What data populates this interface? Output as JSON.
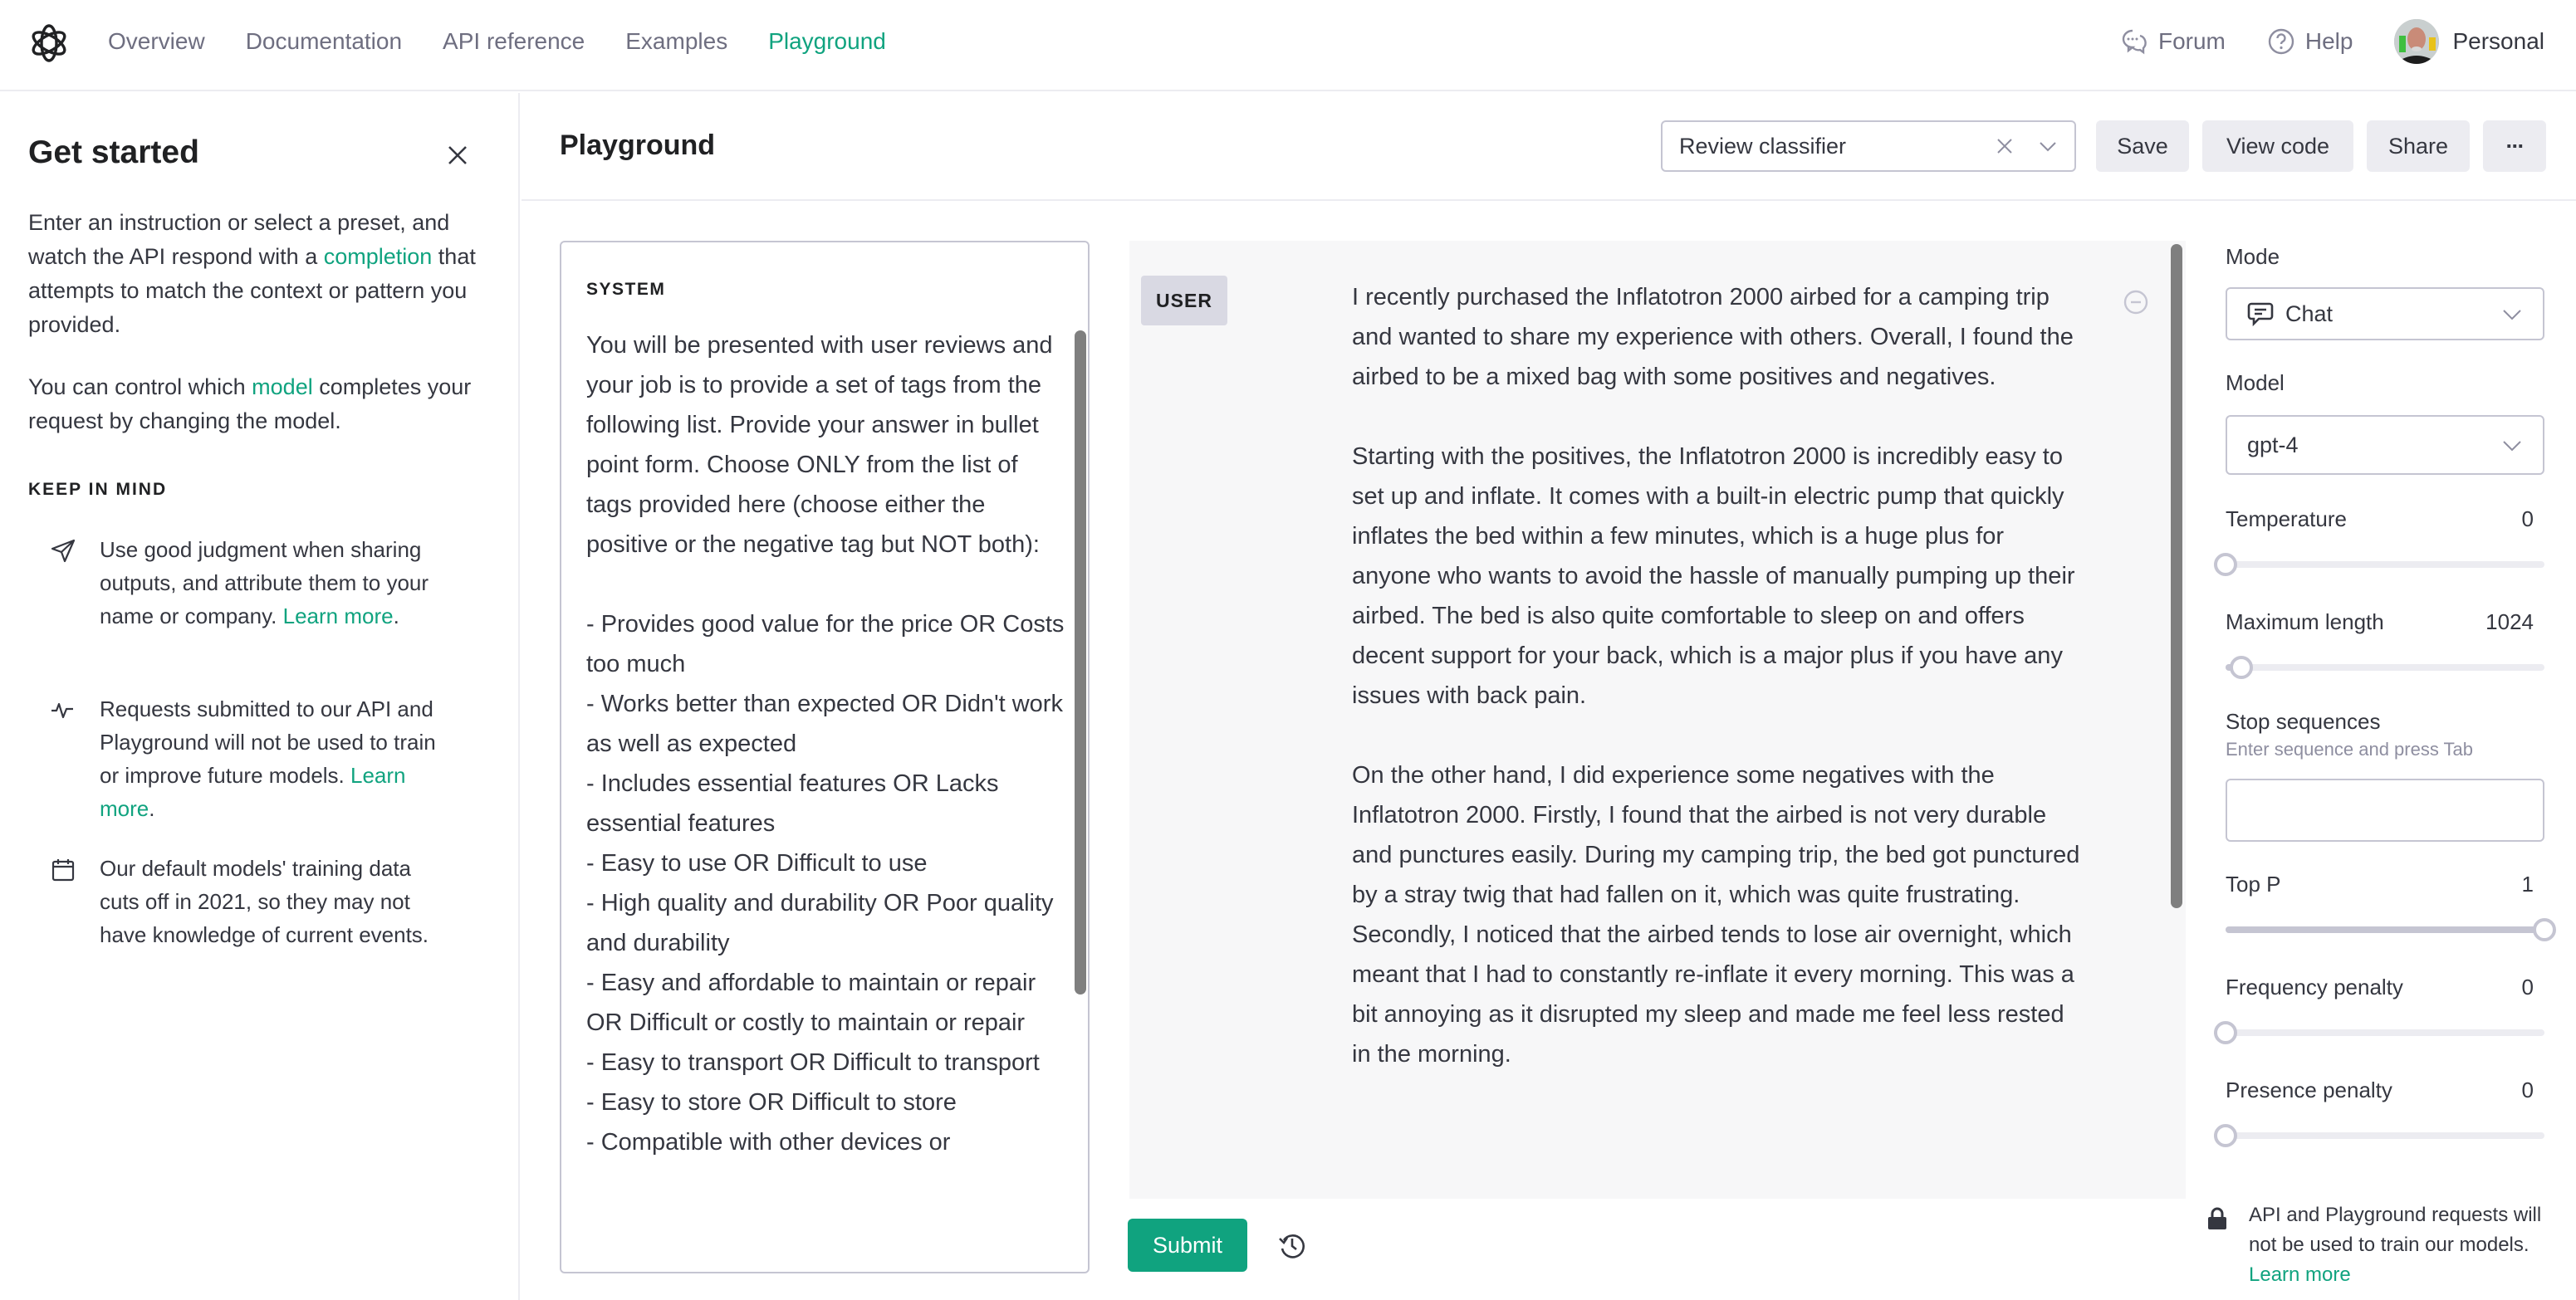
{
  "nav": {
    "links": [
      {
        "label": "Overview",
        "active": false
      },
      {
        "label": "Documentation",
        "active": false
      },
      {
        "label": "API reference",
        "active": false
      },
      {
        "label": "Examples",
        "active": false
      },
      {
        "label": "Playground",
        "active": true
      }
    ],
    "forum_label": "Forum",
    "help_label": "Help",
    "account_label": "Personal"
  },
  "sidebar": {
    "title": "Get started",
    "intro_before_link": "Enter an instruction or select a preset, and watch the API respond with a ",
    "intro_link": "completion",
    "intro_after_link": " that attempts to match the context or pattern you provided.",
    "model_before_link": "You can control which ",
    "model_link": "model",
    "model_after_link": " completes your request by changing the model.",
    "keep_in_mind_heading": "KEEP IN MIND",
    "tips": [
      {
        "icon": "send-icon",
        "text": "Use good judgment when sharing outputs, and attribute them to your name or company. ",
        "link": "Learn more",
        "suffix": "."
      },
      {
        "icon": "activity-icon",
        "text": "Requests submitted to our API and Playground will not be used to train or improve future models. ",
        "link": "Learn more",
        "suffix": "."
      },
      {
        "icon": "calendar-icon",
        "text": "Our default models' training data cuts off in 2021, so they may not have knowledge of current events.",
        "link": "",
        "suffix": ""
      }
    ]
  },
  "header": {
    "title": "Playground",
    "preset_value": "Review classifier",
    "save_label": "Save",
    "view_code_label": "View code",
    "share_label": "Share",
    "more_label": "···"
  },
  "system": {
    "label": "SYSTEM",
    "text": "You will be presented with user reviews and your job is to provide a set of tags from the following list. Provide your answer in bullet point form. Choose ONLY from the list of tags provided here (choose either the positive or the negative tag but NOT both):\n\n- Provides good value for the price OR Costs too much\n- Works better than expected OR Didn't work as well as expected\n- Includes essential features OR Lacks essential features\n- Easy to use OR Difficult to use\n- High quality and durability OR Poor quality and durability\n- Easy and affordable to maintain or repair OR Difficult or costly to maintain or repair\n- Easy to transport OR Difficult to transport\n- Easy to store OR Difficult to store\n- Compatible with other devices or"
  },
  "messages": [
    {
      "role": "USER",
      "paragraphs": [
        "I recently purchased the Inflatotron 2000 airbed for a camping trip and wanted to share my experience with others. Overall, I found the airbed to be a mixed bag with some positives and negatives.",
        "Starting with the positives, the Inflatotron 2000 is incredibly easy to set up and inflate. It comes with a built-in electric pump that quickly inflates the bed within a few minutes, which is a huge plus for anyone who wants to avoid the hassle of manually pumping up their airbed. The bed is also quite comfortable to sleep on and offers decent support for your back, which is a major plus if you have any issues with back pain.",
        "On the other hand, I did experience some negatives with the Inflatotron 2000. Firstly, I found that the airbed is not very durable and punctures easily. During my camping trip, the bed got punctured by a stray twig that had fallen on it, which was quite frustrating. Secondly, I noticed that the airbed tends to lose air overnight, which meant that I had to constantly re-inflate it every morning. This was a bit annoying as it disrupted my sleep and made me feel less rested in the morning."
      ]
    }
  ],
  "actions": {
    "submit_label": "Submit"
  },
  "settings": {
    "mode_label": "Mode",
    "mode_value": "Chat",
    "model_label": "Model",
    "model_value": "gpt-4",
    "temperature": {
      "label": "Temperature",
      "value": "0",
      "fraction": 0.0
    },
    "max_length": {
      "label": "Maximum length",
      "value": "1024",
      "fraction": 0.05
    },
    "stop_sequences": {
      "label": "Stop sequences",
      "hint": "Enter sequence and press Tab",
      "value": ""
    },
    "top_p": {
      "label": "Top P",
      "value": "1",
      "fraction": 1.0
    },
    "frequency_penalty": {
      "label": "Frequency penalty",
      "value": "0",
      "fraction": 0.0
    },
    "presence_penalty": {
      "label": "Presence penalty",
      "value": "0",
      "fraction": 0.0
    },
    "privacy_text": "API and Playground requests will not be used to train our models. ",
    "privacy_link": "Learn more"
  },
  "colors": {
    "accent": "#10a37f",
    "text": "#353740",
    "muted": "#6e6e80",
    "border": "#c5c5d2",
    "panel_bg": "#f7f7f8",
    "button_bg": "#ececf1"
  }
}
